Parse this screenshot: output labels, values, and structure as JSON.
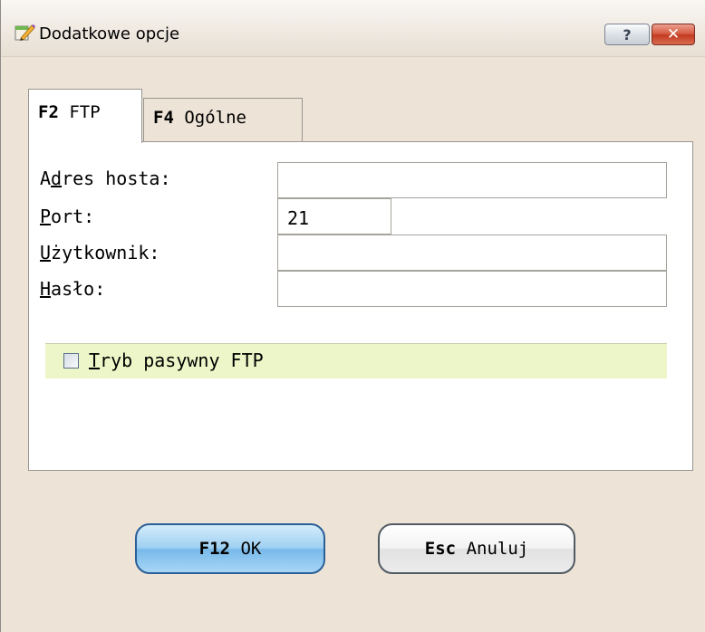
{
  "window": {
    "title": "Dodatkowe opcje",
    "help_glyph": "?",
    "close_glyph": "✕",
    "accent_colors": {
      "band": "#edf6c8",
      "ok_button": "#9fd0f2",
      "close_button": "#c2391f"
    }
  },
  "tabs": [
    {
      "key": "F2",
      "label": "FTP",
      "active": true
    },
    {
      "key": "F4",
      "label": "Ogólne",
      "active": false
    }
  ],
  "form": {
    "host": {
      "label_pre": "A",
      "label_ul": "d",
      "label_post": "res hosta:",
      "value": ""
    },
    "port": {
      "label_pre": "",
      "label_ul": "P",
      "label_post": "ort:",
      "value": "21"
    },
    "user": {
      "label_pre": "",
      "label_ul": "U",
      "label_post": "żytkownik:",
      "value": ""
    },
    "password": {
      "label_pre": "",
      "label_ul": "H",
      "label_post": "asło:",
      "value": ""
    },
    "passive": {
      "label_ul": "T",
      "label_post": "ryb pasywny FTP",
      "checked": false
    }
  },
  "buttons": {
    "ok": {
      "key": "F12",
      "label": "OK"
    },
    "cancel": {
      "key": "Esc",
      "label": "Anuluj"
    }
  }
}
